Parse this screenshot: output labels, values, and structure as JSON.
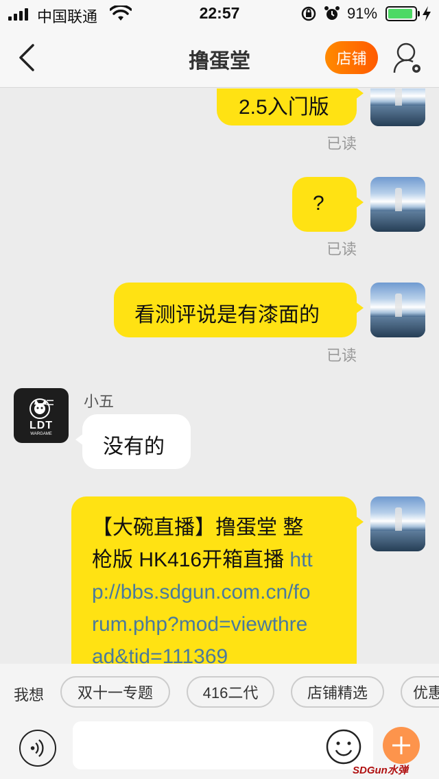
{
  "status_bar": {
    "carrier": "中国联通",
    "time": "22:57",
    "battery_percent": "91%",
    "battery_level": 0.91
  },
  "nav": {
    "title": "撸蛋堂",
    "shop_button": "店铺"
  },
  "messages": [
    {
      "side": "right",
      "text": "2.5入门版",
      "status": "已读"
    },
    {
      "side": "right",
      "text": "?",
      "status": "已读"
    },
    {
      "side": "right",
      "text": "看测评说是有漆面的",
      "status": "已读"
    },
    {
      "side": "left",
      "sender": "小五",
      "text": "没有的",
      "avatar_text": "LDT",
      "avatar_subtext": "WARGAME"
    },
    {
      "side": "right",
      "text_lines": [
        "【大碗直播】撸蛋堂 整",
        "枪版 HK416开箱直播 "
      ],
      "link_lines": [
        "htt",
        "p://bbs.sdgun.com.cn/fo",
        "rum.php?mod=viewthre",
        "ad&tid=111369"
      ]
    }
  ],
  "quick_replies": {
    "label": "我想",
    "chips": [
      "双十一专题",
      "416二代",
      "店铺精选",
      "优惠"
    ]
  },
  "input": {
    "placeholder": "",
    "value": ""
  },
  "watermark": "SDGun水弹",
  "icons": [
    "signal-icon",
    "wifi-icon",
    "orientation-lock-icon",
    "alarm-icon",
    "battery-icon",
    "charging-icon",
    "back-arrow-icon",
    "user-settings-icon",
    "voice-icon",
    "emoji-icon",
    "plus-icon"
  ],
  "colors": {
    "my_bubble": "#ffe213",
    "their_bubble": "#ffffff",
    "shop_button": "#ff6a00",
    "link": "#4a7a9c",
    "background": "#ececec"
  }
}
